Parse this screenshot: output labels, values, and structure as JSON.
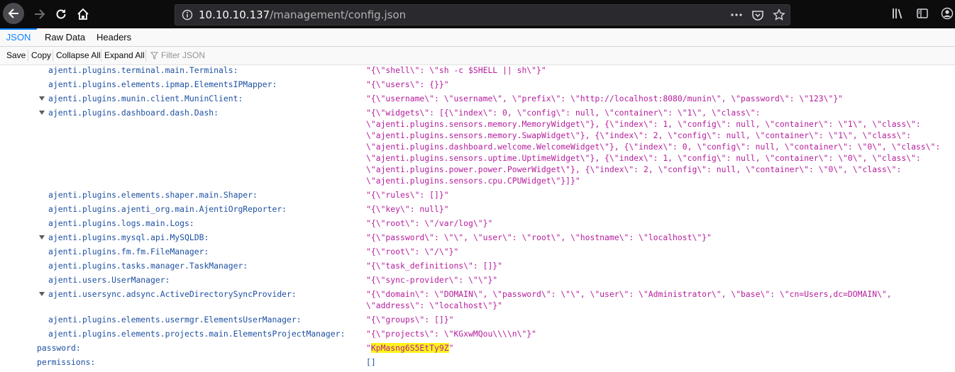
{
  "browser": {
    "url_host": "10.10.10.137",
    "url_path": "/management/config.json"
  },
  "viewer": {
    "tabs": [
      "JSON",
      "Raw Data",
      "Headers"
    ],
    "toolbar": [
      "Save",
      "Copy",
      "Collapse All",
      "Expand All"
    ],
    "filter_placeholder": "Filter JSON"
  },
  "rows": [
    {
      "key": "ajenti.plugins.terminal.main.Terminals:",
      "value": "\"{\\\"shell\\\": \\\"sh -c $SHELL || sh\\\"}\""
    },
    {
      "key": "ajenti.plugins.elements.ipmap.ElementsIPMapper:",
      "value": "\"{\\\"users\\\": {}}\""
    },
    {
      "key": "ajenti.plugins.munin.client.MuninClient:",
      "value": "\"{\\\"username\\\": \\\"username\\\", \\\"prefix\\\": \\\"http://localhost:8080/munin\\\", \\\"password\\\": \\\"123\\\"}\""
    },
    {
      "key": "ajenti.plugins.dashboard.dash.Dash:",
      "value": "\"{\\\"widgets\\\": [{\\\"index\\\": 0, \\\"config\\\": null, \\\"container\\\": \\\"1\\\", \\\"class\\\":\n\\\"ajenti.plugins.sensors.memory.MemoryWidget\\\"}, {\\\"index\\\": 1, \\\"config\\\": null, \\\"container\\\": \\\"1\\\", \\\"class\\\":\n\\\"ajenti.plugins.sensors.memory.SwapWidget\\\"}, {\\\"index\\\": 2, \\\"config\\\": null, \\\"container\\\": \\\"1\\\", \\\"class\\\":\n\\\"ajenti.plugins.dashboard.welcome.WelcomeWidget\\\"}, {\\\"index\\\": 0, \\\"config\\\": null, \\\"container\\\": \\\"0\\\", \\\"class\\\":\n\\\"ajenti.plugins.sensors.uptime.UptimeWidget\\\"}, {\\\"index\\\": 1, \\\"config\\\": null, \\\"container\\\": \\\"0\\\", \\\"class\\\":\n\\\"ajenti.plugins.power.power.PowerWidget\\\"}, {\\\"index\\\": 2, \\\"config\\\": null, \\\"container\\\": \\\"0\\\", \\\"class\\\":\n\\\"ajenti.plugins.sensors.cpu.CPUWidget\\\"}]}\""
    },
    {
      "key": "ajenti.plugins.elements.shaper.main.Shaper:",
      "value": "\"{\\\"rules\\\": []}\""
    },
    {
      "key": "ajenti.plugins.ajenti_org.main.AjentiOrgReporter:",
      "value": "\"{\\\"key\\\": null}\""
    },
    {
      "key": "ajenti.plugins.logs.main.Logs:",
      "value": "\"{\\\"root\\\": \\\"/var/log\\\"}\""
    },
    {
      "key": "ajenti.plugins.mysql.api.MySQLDB:",
      "value": "\"{\\\"password\\\": \\\"\\\", \\\"user\\\": \\\"root\\\", \\\"hostname\\\": \\\"localhost\\\"}\""
    },
    {
      "key": "ajenti.plugins.fm.fm.FileManager:",
      "value": "\"{\\\"root\\\": \\\"/\\\"}\""
    },
    {
      "key": "ajenti.plugins.tasks.manager.TaskManager:",
      "value": "\"{\\\"task_definitions\\\": []}\""
    },
    {
      "key": "ajenti.users.UserManager:",
      "value": "\"{\\\"sync-provider\\\": \\\"\\\"}\""
    },
    {
      "key": "ajenti.usersync.adsync.ActiveDirectorySyncProvider:",
      "value": "\"{\\\"domain\\\": \\\"DOMAIN\\\", \\\"password\\\": \\\"\\\", \\\"user\\\": \\\"Administrator\\\", \\\"base\\\": \\\"cn=Users,dc=DOMAIN\\\",\n\\\"address\\\": \\\"localhost\\\"}\""
    },
    {
      "key": "ajenti.plugins.elements.usermgr.ElementsUserManager:",
      "value": "\"{\\\"groups\\\": []}\""
    },
    {
      "key": "ajenti.plugins.elements.projects.main.ElementsProjectManager:",
      "value": "\"{\\\"projects\\\": \\\"KGxwMQou\\\\\\\\n\\\"}\""
    }
  ],
  "password": {
    "key": "password:",
    "value": "KpMasng6S5EtTy9Z"
  },
  "permissions": {
    "key": "permissions:",
    "value": "[]"
  }
}
